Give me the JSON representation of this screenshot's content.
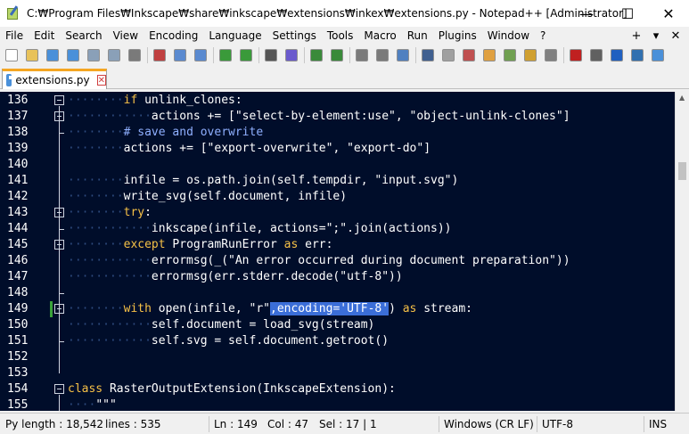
{
  "window": {
    "title": "C:₩Program Files₩Inkscape₩share₩inkscape₩extensions₩inkex₩extensions.py - Notepad++ [Administrator]",
    "icon": "notepad-plus-plus-icon",
    "controls": {
      "minimize": "—",
      "maximize": "☐",
      "close": "✕"
    }
  },
  "menu": {
    "items": [
      "File",
      "Edit",
      "Search",
      "View",
      "Encoding",
      "Language",
      "Settings",
      "Tools",
      "Macro",
      "Run",
      "Plugins",
      "Window",
      "?"
    ],
    "right": [
      "+",
      "▾",
      "✕"
    ]
  },
  "toolbar": {
    "icons": [
      "new-file-icon",
      "open-file-icon",
      "save-icon",
      "save-all-icon",
      "close-icon",
      "close-all-icon",
      "print-icon",
      "cut-icon",
      "copy-icon",
      "paste-icon",
      "undo-icon",
      "redo-icon",
      "find-icon",
      "replace-icon",
      "zoom-in-icon",
      "zoom-out-icon",
      "sync-vertical-icon",
      "sync-horizontal-icon",
      "word-wrap-icon",
      "show-all-chars-icon",
      "indent-guide-icon",
      "udl-icon",
      "document-map-icon",
      "function-list-icon",
      "folder-workspace-icon",
      "monitoring-icon",
      "record-macro-icon",
      "stop-macro-icon",
      "play-macro-icon",
      "run-macro-multiple-icon",
      "save-macro-icon"
    ]
  },
  "tab": {
    "label": "extensions.py",
    "close": "✕"
  },
  "editor": {
    "colors": {
      "background": "#000d2a",
      "keyword": "#f6c147",
      "comment": "#8fb0ff",
      "selection": "#3b6ed8"
    },
    "lines": [
      {
        "num": "136",
        "segments": [
          [
            "ws",
            "········"
          ],
          [
            "kw",
            "if"
          ],
          [
            "id",
            " unlink_clones:"
          ]
        ]
      },
      {
        "num": "137",
        "segments": [
          [
            "ws",
            "············"
          ],
          [
            "id",
            "actions += ["
          ],
          [
            "str",
            "\"select-by-element:use\""
          ],
          [
            "id",
            ", "
          ],
          [
            "str",
            "\"object-unlink-clones\""
          ],
          [
            "id",
            "]"
          ]
        ]
      },
      {
        "num": "138",
        "segments": [
          [
            "ws",
            "········"
          ],
          [
            "cm",
            "# save and overwrite"
          ]
        ]
      },
      {
        "num": "139",
        "segments": [
          [
            "ws",
            "········"
          ],
          [
            "id",
            "actions += ["
          ],
          [
            "str",
            "\"export-overwrite\""
          ],
          [
            "id",
            ", "
          ],
          [
            "str",
            "\"export-do\""
          ],
          [
            "id",
            "]"
          ]
        ]
      },
      {
        "num": "140",
        "segments": []
      },
      {
        "num": "141",
        "segments": [
          [
            "ws",
            "········"
          ],
          [
            "id",
            "infile = os.path.join(self.tempdir, "
          ],
          [
            "str",
            "\"input.svg\""
          ],
          [
            "id",
            ")"
          ]
        ]
      },
      {
        "num": "142",
        "segments": [
          [
            "ws",
            "········"
          ],
          [
            "id",
            "write_svg(self.document, infile)"
          ]
        ]
      },
      {
        "num": "143",
        "segments": [
          [
            "ws",
            "········"
          ],
          [
            "kw",
            "try"
          ],
          [
            "id",
            ":"
          ]
        ]
      },
      {
        "num": "144",
        "segments": [
          [
            "ws",
            "············"
          ],
          [
            "id",
            "inkscape(infile, actions="
          ],
          [
            "str",
            "\";\""
          ],
          [
            "id",
            ".join(actions))"
          ]
        ]
      },
      {
        "num": "145",
        "segments": [
          [
            "ws",
            "········"
          ],
          [
            "kw",
            "except"
          ],
          [
            "id",
            " ProgramRunError "
          ],
          [
            "kw",
            "as"
          ],
          [
            "id",
            " err:"
          ]
        ]
      },
      {
        "num": "146",
        "segments": [
          [
            "ws",
            "············"
          ],
          [
            "id",
            "errormsg(_("
          ],
          [
            "str",
            "\"An error occurred during document preparation\""
          ],
          [
            "id",
            "))"
          ]
        ]
      },
      {
        "num": "147",
        "segments": [
          [
            "ws",
            "············"
          ],
          [
            "id",
            "errormsg(err.stderr.decode("
          ],
          [
            "str",
            "\"utf-8\""
          ],
          [
            "id",
            "))"
          ]
        ]
      },
      {
        "num": "148",
        "segments": []
      },
      {
        "num": "149",
        "segments": [
          [
            "ws",
            "········"
          ],
          [
            "kw",
            "with"
          ],
          [
            "id",
            " open(infile, "
          ],
          [
            "str",
            "\"r\""
          ],
          [
            "sel",
            ",encoding='UTF-8'"
          ],
          [
            "id",
            ") "
          ],
          [
            "kw",
            "as"
          ],
          [
            "id",
            " stream:"
          ]
        ]
      },
      {
        "num": "150",
        "segments": [
          [
            "ws",
            "············"
          ],
          [
            "id",
            "self.document = load_svg(stream)"
          ]
        ]
      },
      {
        "num": "151",
        "segments": [
          [
            "ws",
            "············"
          ],
          [
            "id",
            "self.svg = self.document.getroot()"
          ]
        ]
      },
      {
        "num": "152",
        "segments": []
      },
      {
        "num": "153",
        "segments": []
      },
      {
        "num": "154",
        "segments": [
          [
            "kw",
            "class"
          ],
          [
            "id",
            " RasterOutputExtension(InkscapeExtension):"
          ]
        ]
      },
      {
        "num": "155",
        "segments": [
          [
            "ws",
            "····"
          ],
          [
            "str",
            "\"\"\""
          ]
        ]
      }
    ],
    "scroll_position": 0.21
  },
  "status": {
    "length": "Py length : 18,542",
    "lines": "lines : 535",
    "ln": "Ln : 149",
    "col": "Col : 47",
    "sel": "Sel : 17 | 1",
    "eol": "Windows (CR LF)",
    "encoding": "UTF-8",
    "mode": "INS"
  }
}
